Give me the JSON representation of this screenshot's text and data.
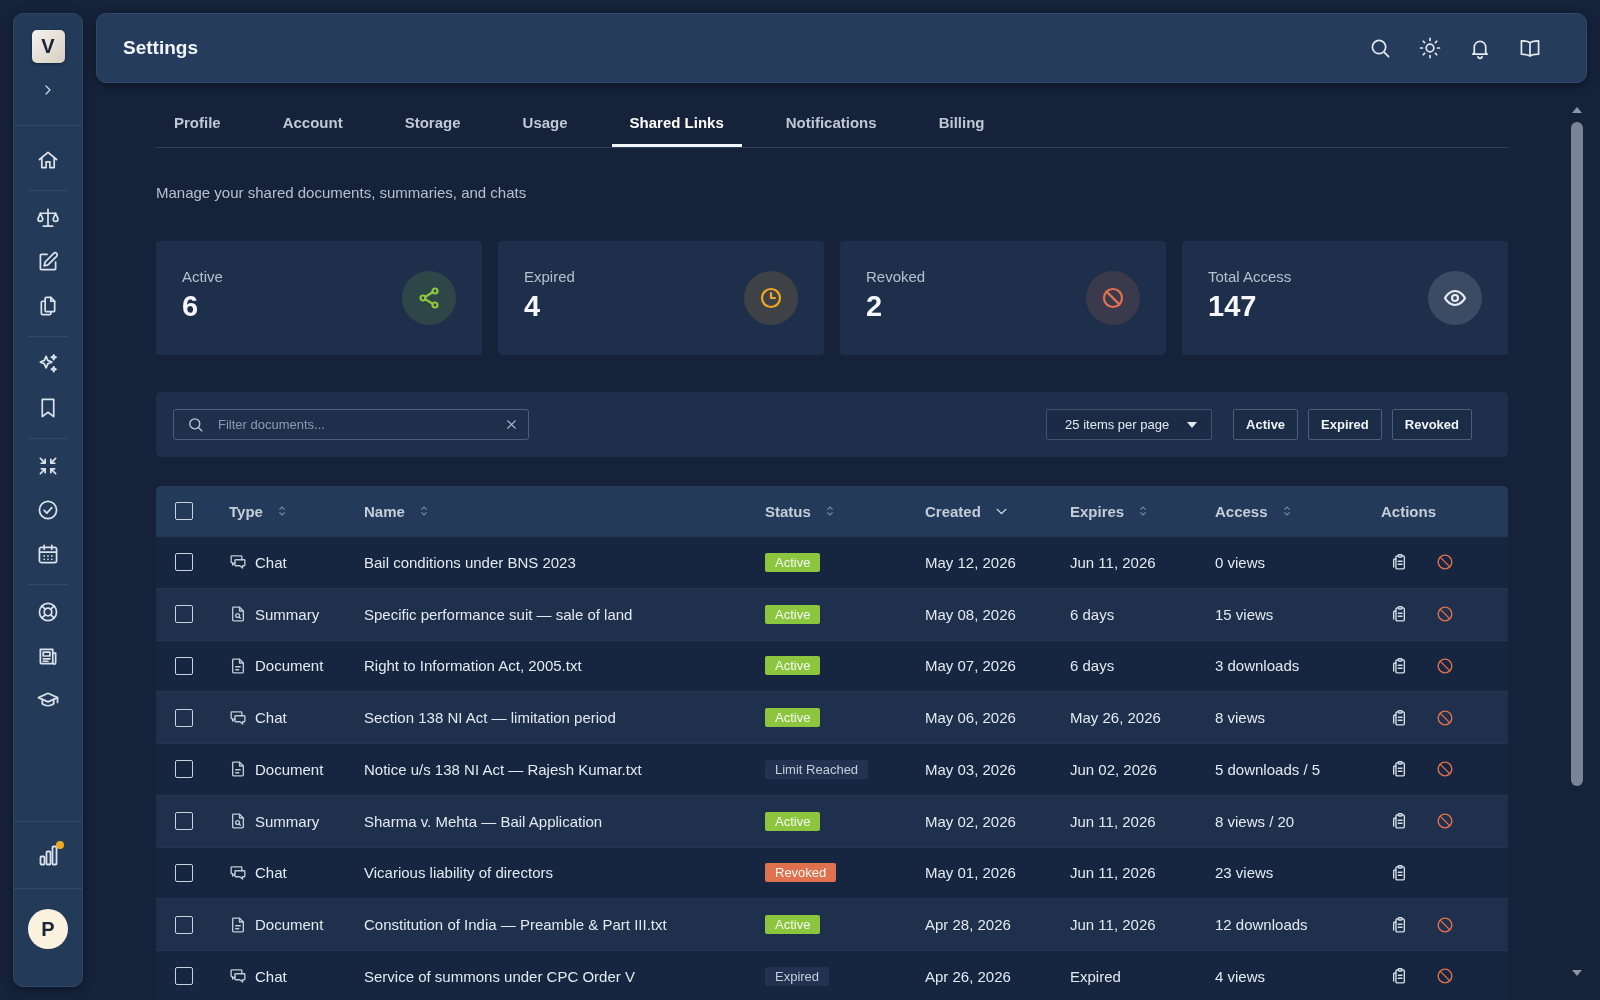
{
  "sidebar": {
    "logo": "V",
    "usage_alert": true,
    "avatar": "P"
  },
  "header": {
    "title": "Settings"
  },
  "tabs": [
    {
      "label": "Profile",
      "selected": false
    },
    {
      "label": "Account",
      "selected": false
    },
    {
      "label": "Storage",
      "selected": false
    },
    {
      "label": "Usage",
      "selected": false
    },
    {
      "label": "Shared Links",
      "selected": true
    },
    {
      "label": "Notifications",
      "selected": false
    },
    {
      "label": "Billing",
      "selected": false
    }
  ],
  "description": "Manage your shared documents, summaries, and chats",
  "stats": [
    {
      "label": "Active",
      "value": "6",
      "kind": "share",
      "color": "#8cc63f"
    },
    {
      "label": "Expired",
      "value": "4",
      "kind": "clock",
      "color": "#f0a824"
    },
    {
      "label": "Revoked",
      "value": "2",
      "kind": "ban",
      "color": "#e0714f"
    },
    {
      "label": "Total Access",
      "value": "147",
      "kind": "eye",
      "color": "#e6ebf1"
    }
  ],
  "filters": {
    "search": {
      "placeholder": "Filter documents..."
    },
    "page_size": "25 items per page",
    "status_buttons": [
      {
        "label": "Active",
        "selected": false
      },
      {
        "label": "Expired",
        "selected": false
      },
      {
        "label": "Revoked",
        "selected": false
      }
    ]
  },
  "table": {
    "all_selected": false,
    "columns": [
      {
        "label": "Type",
        "sortable": true,
        "sorted": false
      },
      {
        "label": "Name",
        "sortable": true,
        "sorted": false
      },
      {
        "label": "Status",
        "sortable": true,
        "sorted": false
      },
      {
        "label": "Created",
        "sortable": true,
        "sorted": true
      },
      {
        "label": "Expires",
        "sortable": true,
        "sorted": false
      },
      {
        "label": "Access",
        "sortable": true,
        "sorted": false
      },
      {
        "label": "Actions",
        "sortable": false,
        "sorted": false
      }
    ],
    "rows": [
      {
        "selected": false,
        "kind": "chat",
        "type": "Chat",
        "name": "Bail conditions under BNS 2023",
        "status": {
          "label": "Active",
          "color": "#8cc63f"
        },
        "created": "May 12, 2026",
        "expires": "Jun 11, 2026",
        "access": "0 views",
        "revocable": true
      },
      {
        "selected": false,
        "kind": "summary",
        "type": "Summary",
        "name": "Specific performance suit — sale of land",
        "status": {
          "label": "Active",
          "color": "#8cc63f"
        },
        "created": "May 08, 2026",
        "expires": "6 days",
        "access": "15 views",
        "revocable": true
      },
      {
        "selected": false,
        "kind": "document",
        "type": "Document",
        "name": "Right to Information Act, 2005.txt",
        "status": {
          "label": "Active",
          "color": "#8cc63f"
        },
        "created": "May 07, 2026",
        "expires": "6 days",
        "access": "3 downloads",
        "revocable": true
      },
      {
        "selected": false,
        "kind": "chat",
        "type": "Chat",
        "name": "Section 138 NI Act — limitation period",
        "status": {
          "label": "Active",
          "color": "#8cc63f"
        },
        "created": "May 06, 2026",
        "expires": "May 26, 2026",
        "access": "8 views",
        "revocable": true
      },
      {
        "selected": false,
        "kind": "document",
        "type": "Document",
        "name": "Notice u/s 138 NI Act — Rajesh Kumar.txt",
        "status": {
          "label": "Limit Reached",
          "color": "#223250"
        },
        "created": "May 03, 2026",
        "expires": "Jun 02, 2026",
        "access": "5 downloads / 5",
        "revocable": true
      },
      {
        "selected": false,
        "kind": "summary",
        "type": "Summary",
        "name": "Sharma v. Mehta — Bail Application",
        "status": {
          "label": "Active",
          "color": "#8cc63f"
        },
        "created": "May 02, 2026",
        "expires": "Jun 11, 2026",
        "access": "8 views / 20",
        "revocable": true
      },
      {
        "selected": false,
        "kind": "chat",
        "type": "Chat",
        "name": "Vicarious liability of directors",
        "status": {
          "label": "Revoked",
          "color": "#e0714f"
        },
        "created": "May 01, 2026",
        "expires": "Jun 11, 2026",
        "access": "23 views",
        "revocable": false
      },
      {
        "selected": false,
        "kind": "document",
        "type": "Document",
        "name": "Constitution of India — Preamble & Part III.txt",
        "status": {
          "label": "Active",
          "color": "#8cc63f"
        },
        "created": "Apr 28, 2026",
        "expires": "Jun 11, 2026",
        "access": "12 downloads",
        "revocable": true
      },
      {
        "selected": false,
        "kind": "chat",
        "type": "Chat",
        "name": "Service of summons under CPC Order V",
        "status": {
          "label": "Expired",
          "color": "#223250"
        },
        "created": "Apr 26, 2026",
        "expires": "Expired",
        "access": "4 views",
        "revocable": true
      }
    ]
  }
}
